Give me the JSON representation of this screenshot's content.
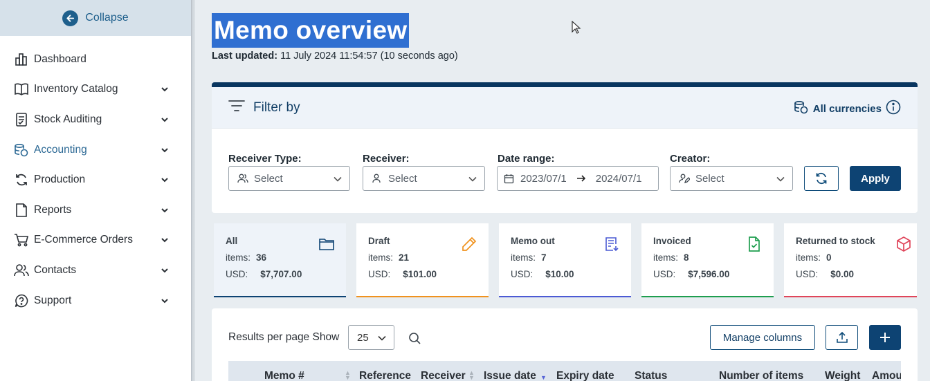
{
  "sidebar": {
    "collapse_label": "Collapse",
    "items": [
      {
        "label": "Dashboard",
        "icon": "dashboard-icon",
        "has_chevron": false
      },
      {
        "label": "Inventory Catalog",
        "icon": "book-icon",
        "has_chevron": true
      },
      {
        "label": "Stock Auditing",
        "icon": "clipboard-check-icon",
        "has_chevron": true
      },
      {
        "label": "Accounting",
        "icon": "coins-icon",
        "has_chevron": true,
        "active": true
      },
      {
        "label": "Production",
        "icon": "refresh-icon",
        "has_chevron": true
      },
      {
        "label": "Reports",
        "icon": "document-icon",
        "has_chevron": true
      },
      {
        "label": "E-Commerce Orders",
        "icon": "cart-icon",
        "has_chevron": true
      },
      {
        "label": "Contacts",
        "icon": "users-icon",
        "has_chevron": true
      },
      {
        "label": "Support",
        "icon": "help-icon",
        "has_chevron": true
      }
    ]
  },
  "page": {
    "title": "Memo overview",
    "last_updated_label": "Last updated:",
    "last_updated_value": "11 July 2024 11:54:57 (10 seconds ago)"
  },
  "filter": {
    "title": "Filter by",
    "currencies_label": "All currencies",
    "receiver_type_label": "Receiver Type:",
    "receiver_type_placeholder": "Select",
    "receiver_label": "Receiver:",
    "receiver_placeholder": "Select",
    "date_range_label": "Date range:",
    "date_from": "2023/07/1",
    "date_to": "2024/07/1",
    "creator_label": "Creator:",
    "creator_placeholder": "Select",
    "apply_label": "Apply"
  },
  "status_cards": [
    {
      "name": "All",
      "items_label": "items:",
      "items": "36",
      "currency": "USD:",
      "amount": "$7,707.00",
      "color": "#0d4373",
      "icon": "folder-icon"
    },
    {
      "name": "Draft",
      "items_label": "items:",
      "items": "21",
      "currency": "USD:",
      "amount": "$101.00",
      "color": "#f0921e",
      "icon": "pencil-icon"
    },
    {
      "name": "Memo out",
      "items_label": "items:",
      "items": "7",
      "currency": "USD:",
      "amount": "$10.00",
      "color": "#4c5bd4",
      "icon": "memo-out-icon"
    },
    {
      "name": "Invoiced",
      "items_label": "items:",
      "items": "8",
      "currency": "USD:",
      "amount": "$7,596.00",
      "color": "#1e9e4f",
      "icon": "file-check-icon"
    },
    {
      "name": "Returned to stock",
      "items_label": "items:",
      "items": "0",
      "currency": "USD:",
      "amount": "$0.00",
      "color": "#e0455a",
      "icon": "box-icon"
    }
  ],
  "table": {
    "results_label": "Results per page Show",
    "per_page": "25",
    "manage_columns_label": "Manage columns",
    "columns": [
      "Memo #",
      "Reference",
      "Receiver",
      "Issue date",
      "Expiry date",
      "Status",
      "Number of items",
      "Weight",
      "Amou"
    ]
  },
  "colors": {
    "brand": "#0d4373",
    "accent": "#1e5f8c",
    "selection": "#2f6fd1"
  }
}
